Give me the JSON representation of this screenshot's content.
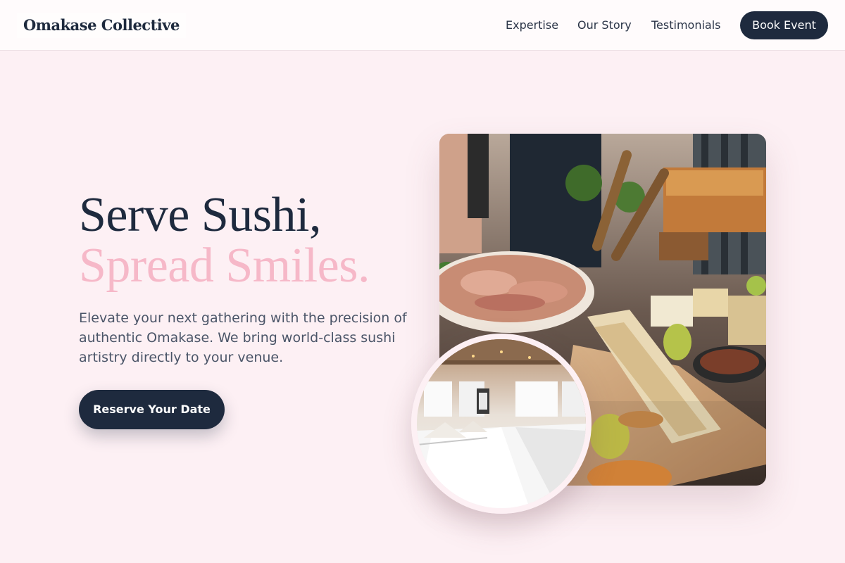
{
  "header": {
    "logo": "Omakase Collective",
    "nav": [
      {
        "label": "Expertise"
      },
      {
        "label": "Our Story"
      },
      {
        "label": "Testimonials"
      }
    ],
    "cta_label": "Book Event"
  },
  "hero": {
    "headline_line1": "Serve Sushi,",
    "headline_line2": "Spread Smiles.",
    "subtitle": "Elevate your next gathering with the precision of authentic Omakase. We bring world-class sushi artistry directly to your venue.",
    "cta_label": "Reserve Your Date"
  },
  "images": {
    "main": "catering buffet spread with charcuterie, cheese and fruit",
    "secondary": "banquet hall with long white-clothed tables"
  },
  "colors": {
    "background": "#fdf0f4",
    "navy": "#1e2a3e",
    "accent_pink": "#f6b8c8",
    "body_text": "#4b5568"
  }
}
